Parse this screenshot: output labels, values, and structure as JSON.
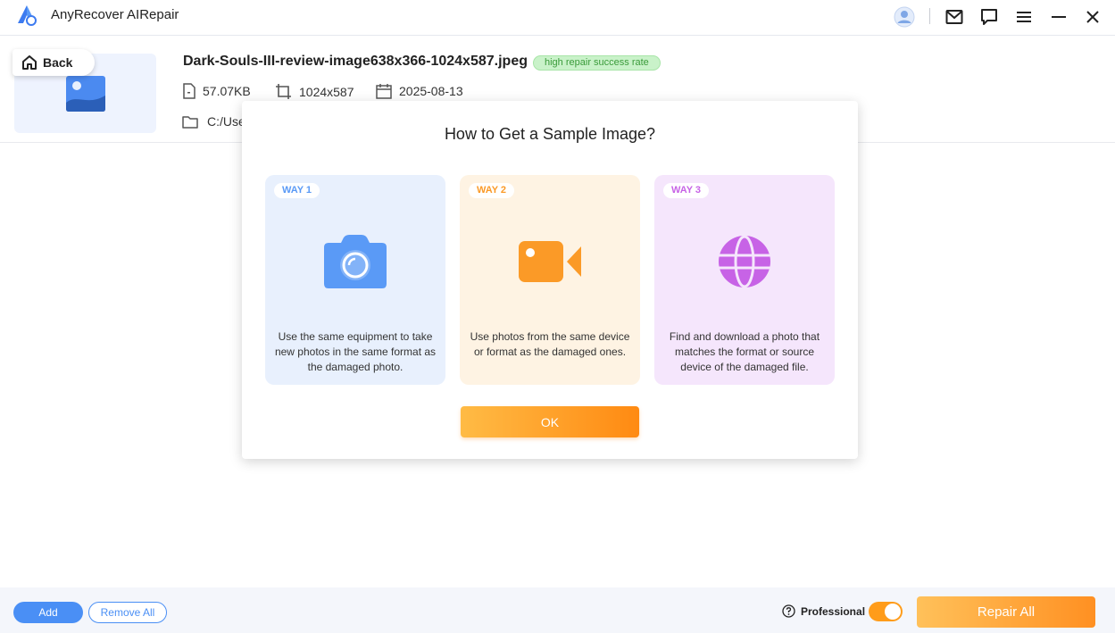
{
  "app": {
    "title": "AnyRecover AIRepair"
  },
  "file": {
    "back_label": "Back",
    "name": "Dark-Souls-III-review-image638x366-1024x587.jpeg",
    "badge": "high repair success rate",
    "size": "57.07KB",
    "dimensions": "1024x587",
    "date": "2025-08-13",
    "path": "C:/Use"
  },
  "modal": {
    "title": "How to Get a Sample Image?",
    "ways": [
      {
        "badge": "WAY 1",
        "icon": "camera-icon",
        "color": "#5a9af6",
        "bg": "#e8f0fd",
        "desc": "Use the same equipment to take new photos in the same format as the damaged photo."
      },
      {
        "badge": "WAY 2",
        "icon": "video-camera-icon",
        "color": "#fb9a27",
        "bg": "#fef3e3",
        "desc": "Use photos from the same device or format as the damaged ones."
      },
      {
        "badge": "WAY 3",
        "icon": "globe-icon",
        "color": "#c763e6",
        "bg": "#f5e6fc",
        "desc": "Find and download a photo that matches the format or source device of the damaged file."
      }
    ],
    "ok_label": "OK"
  },
  "bottom": {
    "add_label": "Add",
    "remove_label": "Remove All",
    "professional_label": "Professional",
    "professional_on": true,
    "repair_label": "Repair All"
  },
  "colors": {
    "accent_blue": "#4a8ff5",
    "accent_orange": "#ff9022",
    "badge_green": "#3a9b3a"
  }
}
